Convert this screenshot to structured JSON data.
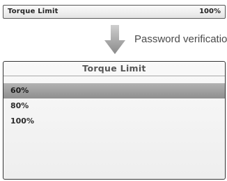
{
  "top_bar": {
    "label": "Torque Limit",
    "value": "100%"
  },
  "arrow": {
    "icon": "down-arrow-icon",
    "caption": "Password verification"
  },
  "panel": {
    "title": "Torque Limit",
    "options": [
      {
        "label": "60%",
        "selected": true
      },
      {
        "label": "80%",
        "selected": false
      },
      {
        "label": "100%",
        "selected": false
      }
    ]
  }
}
